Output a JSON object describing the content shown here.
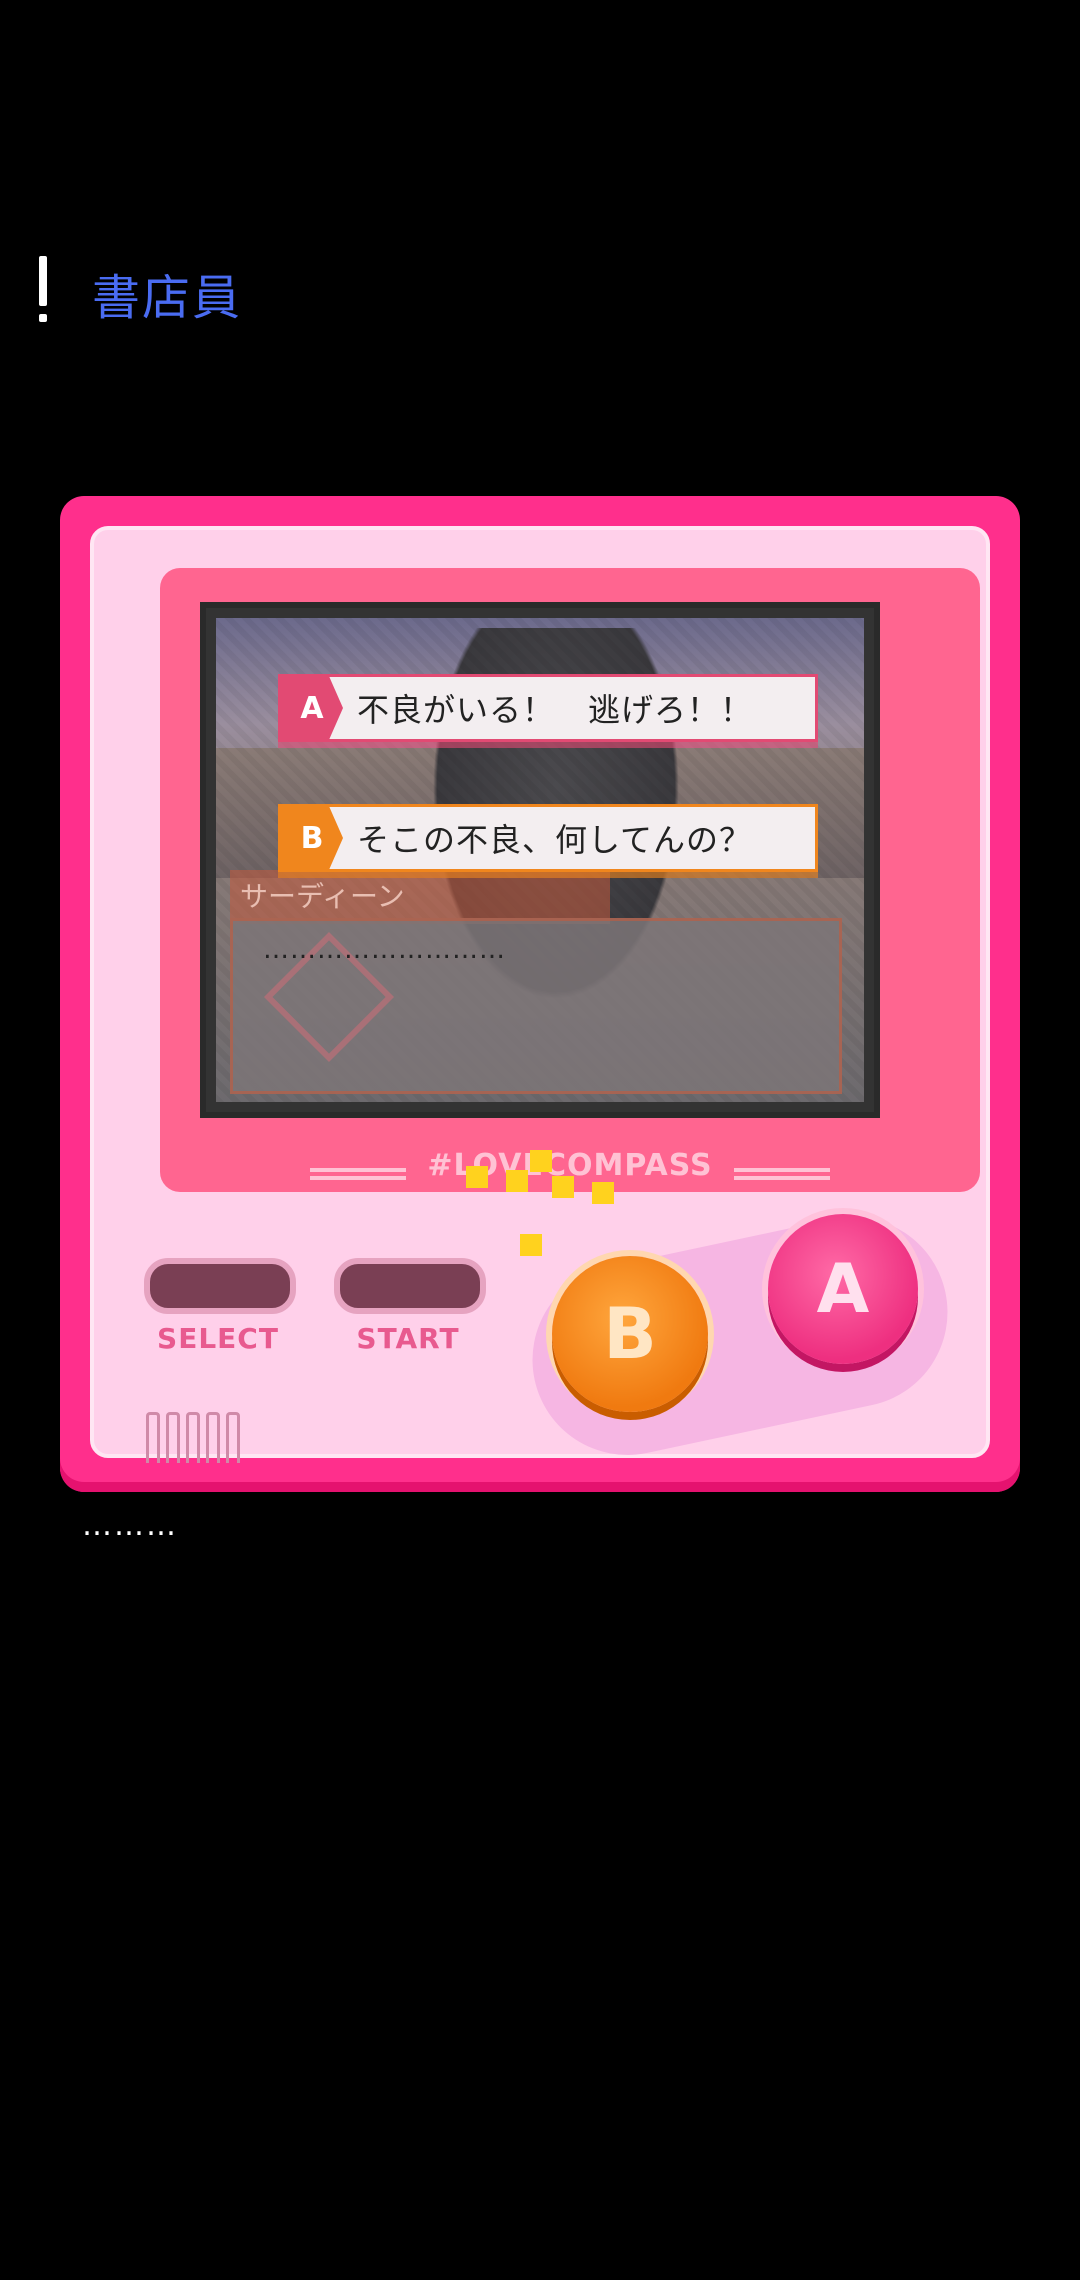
{
  "header": {
    "title": "書店員"
  },
  "game": {
    "choices": [
      {
        "tag": "A",
        "text": "不良がいる！　逃げろ！！"
      },
      {
        "tag": "B",
        "text": "そこの不良、何してんの？"
      }
    ],
    "speaker_name": "サーディーン",
    "dialog_text": "………………………",
    "brand": "#LOVECOMPASS"
  },
  "controls": {
    "select_label": "SELECT",
    "start_label": "START",
    "button_b": "B",
    "button_a": "A"
  },
  "footer": {
    "dots": "………"
  }
}
